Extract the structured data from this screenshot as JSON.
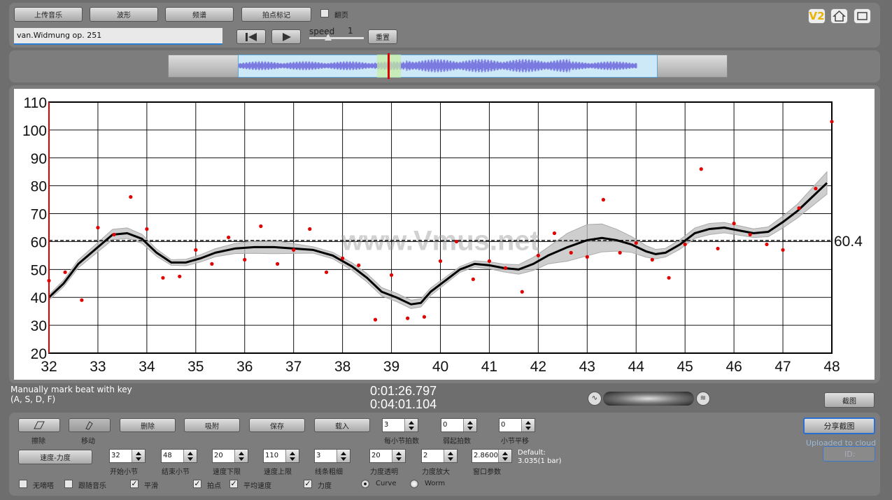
{
  "toolbar": {
    "upload_label": "上传音乐",
    "waveform_label": "波形",
    "spectrum_label": "频谱",
    "beat_mark_label": "拍点标记",
    "flip_page_label": "翻页",
    "track_name": "van.Widmung op. 251",
    "speed_label": "speed",
    "speed_value": "1",
    "reset_label": "重置"
  },
  "top_right_icons": {
    "v2_label": "V2"
  },
  "chart_data": {
    "type": "scatter",
    "xlim": [
      32,
      48
    ],
    "ylim": [
      20,
      110
    ],
    "x_ticks": [
      "32",
      "33",
      "34",
      "35",
      "36",
      "37",
      "38",
      "39",
      "40",
      "41",
      "42",
      "43",
      "44",
      "45",
      "46",
      "47",
      "48"
    ],
    "y_ticks": [
      "20",
      "30",
      "40",
      "50",
      "60",
      "70",
      "80",
      "90",
      "100",
      "110"
    ],
    "grid": true,
    "mean_line": 60.4,
    "mean_label": "60.4",
    "watermark": "www.Vmus.net",
    "points": [
      [
        32.0,
        46
      ],
      [
        32.33,
        49
      ],
      [
        32.67,
        39
      ],
      [
        33.0,
        65
      ],
      [
        33.33,
        62.5
      ],
      [
        33.67,
        76
      ],
      [
        34.0,
        64.5
      ],
      [
        34.33,
        47
      ],
      [
        34.67,
        47.5
      ],
      [
        35.0,
        57
      ],
      [
        35.33,
        52
      ],
      [
        35.67,
        61.5
      ],
      [
        36.0,
        53.5
      ],
      [
        36.33,
        65.5
      ],
      [
        36.67,
        52
      ],
      [
        37.0,
        57
      ],
      [
        37.33,
        64.5
      ],
      [
        37.67,
        49
      ],
      [
        38.0,
        54
      ],
      [
        38.33,
        51.5
      ],
      [
        38.67,
        32
      ],
      [
        39.0,
        48
      ],
      [
        39.33,
        32.5
      ],
      [
        39.67,
        33
      ],
      [
        40.0,
        53
      ],
      [
        40.33,
        60
      ],
      [
        40.67,
        46.5
      ],
      [
        41.0,
        53
      ],
      [
        41.33,
        50.5
      ],
      [
        41.67,
        42
      ],
      [
        42.0,
        55
      ],
      [
        42.33,
        63
      ],
      [
        42.67,
        56
      ],
      [
        43.0,
        54.5
      ],
      [
        43.33,
        75
      ],
      [
        43.67,
        56
      ],
      [
        44.0,
        59.5
      ],
      [
        44.33,
        53.5
      ],
      [
        44.67,
        47
      ],
      [
        45.0,
        59
      ],
      [
        45.33,
        86
      ],
      [
        45.67,
        57.5
      ],
      [
        46.0,
        66.5
      ],
      [
        46.33,
        62.5
      ],
      [
        46.67,
        59
      ],
      [
        47.0,
        57
      ],
      [
        47.33,
        72
      ],
      [
        47.67,
        79
      ],
      [
        48.0,
        103
      ]
    ],
    "smooth_curve": [
      [
        32.0,
        40
      ],
      [
        32.3,
        45
      ],
      [
        32.6,
        52
      ],
      [
        33.0,
        58
      ],
      [
        33.3,
        62.5
      ],
      [
        33.6,
        63
      ],
      [
        33.9,
        61
      ],
      [
        34.2,
        56
      ],
      [
        34.5,
        52.5
      ],
      [
        34.8,
        52.5
      ],
      [
        35.1,
        54
      ],
      [
        35.4,
        56
      ],
      [
        35.8,
        57.5
      ],
      [
        36.2,
        58
      ],
      [
        36.6,
        58
      ],
      [
        37.0,
        57.5
      ],
      [
        37.4,
        57
      ],
      [
        37.8,
        55
      ],
      [
        38.2,
        51
      ],
      [
        38.5,
        47
      ],
      [
        38.8,
        42
      ],
      [
        39.1,
        40
      ],
      [
        39.4,
        37.5
      ],
      [
        39.6,
        38
      ],
      [
        39.8,
        42
      ],
      [
        40.1,
        46
      ],
      [
        40.4,
        50
      ],
      [
        40.7,
        52
      ],
      [
        41.0,
        51.5
      ],
      [
        41.3,
        50.5
      ],
      [
        41.6,
        50
      ],
      [
        41.9,
        52
      ],
      [
        42.2,
        55
      ],
      [
        42.6,
        58
      ],
      [
        43.0,
        60.5
      ],
      [
        43.3,
        61.3
      ],
      [
        43.6,
        60.5
      ],
      [
        43.9,
        59
      ],
      [
        44.2,
        56.5
      ],
      [
        44.4,
        55.5
      ],
      [
        44.6,
        56
      ],
      [
        44.9,
        59
      ],
      [
        45.2,
        63
      ],
      [
        45.5,
        64.5
      ],
      [
        45.8,
        65
      ],
      [
        46.1,
        64
      ],
      [
        46.4,
        63
      ],
      [
        46.7,
        63.5
      ],
      [
        47.0,
        67
      ],
      [
        47.3,
        71
      ],
      [
        47.6,
        76
      ],
      [
        47.9,
        81
      ]
    ],
    "band_width": [
      [
        32.0,
        1
      ],
      [
        33.5,
        2
      ],
      [
        34.5,
        1
      ],
      [
        35.5,
        1.5
      ],
      [
        36.5,
        2.5
      ],
      [
        37.5,
        1
      ],
      [
        38.5,
        1.5
      ],
      [
        39.5,
        1.5
      ],
      [
        40.5,
        1
      ],
      [
        41.5,
        1.5
      ],
      [
        42.2,
        3
      ],
      [
        42.8,
        6
      ],
      [
        43.3,
        5
      ],
      [
        44.0,
        2.5
      ],
      [
        44.5,
        1.5
      ],
      [
        45.5,
        2
      ],
      [
        46.5,
        1.5
      ],
      [
        47.3,
        2.5
      ],
      [
        47.9,
        4
      ]
    ]
  },
  "status": {
    "instruction_line1": "Manually mark beat with key",
    "instruction_line2": "(A, S, D, F)",
    "time_current": "0:01:26.797",
    "time_total": "0:04:01.104",
    "screenshot_label": "截图"
  },
  "controls": {
    "erase_label": "擦除",
    "move_label": "移动",
    "delete_label": "删除",
    "snap_label": "吸附",
    "save_label": "保存",
    "load_label": "载入",
    "beats_per_bar_value": "3",
    "beats_per_bar_label": "每小节拍数",
    "weak_beats_value": "0",
    "weak_beats_label": "弱起拍数",
    "bar_shift_value": "0",
    "bar_shift_label": "小节平移",
    "mode_label": "速度-力度",
    "start_bar_value": "32",
    "start_bar_label": "开始小节",
    "end_bar_value": "48",
    "end_bar_label": "结束小节",
    "tempo_min_value": "20",
    "tempo_min_label": "速度下限",
    "tempo_max_value": "110",
    "tempo_max_label": "速度上限",
    "line_width_value": "3",
    "line_width_label": "线条粗细",
    "dyn_alpha_value": "20",
    "dyn_alpha_label": "力度透明",
    "dyn_scale_value": "2",
    "dyn_scale_label": "力度放大",
    "window_value": "2.8600",
    "window_label": "窗口参数",
    "default_line1": "Default:",
    "default_line2": "3.035(1 bar)",
    "share_label": "分享截图",
    "uploaded_label": "Uploaded to cloud",
    "id_label": "ID:",
    "opt_no_click": "无嘀嗒",
    "opt_follow_music": "跟随音乐",
    "opt_smooth": "平滑",
    "opt_beats": "拍点",
    "opt_avg_tempo": "平均速度",
    "opt_dynamics": "力度",
    "opt_curve": "Curve",
    "opt_worm": "Worm"
  }
}
